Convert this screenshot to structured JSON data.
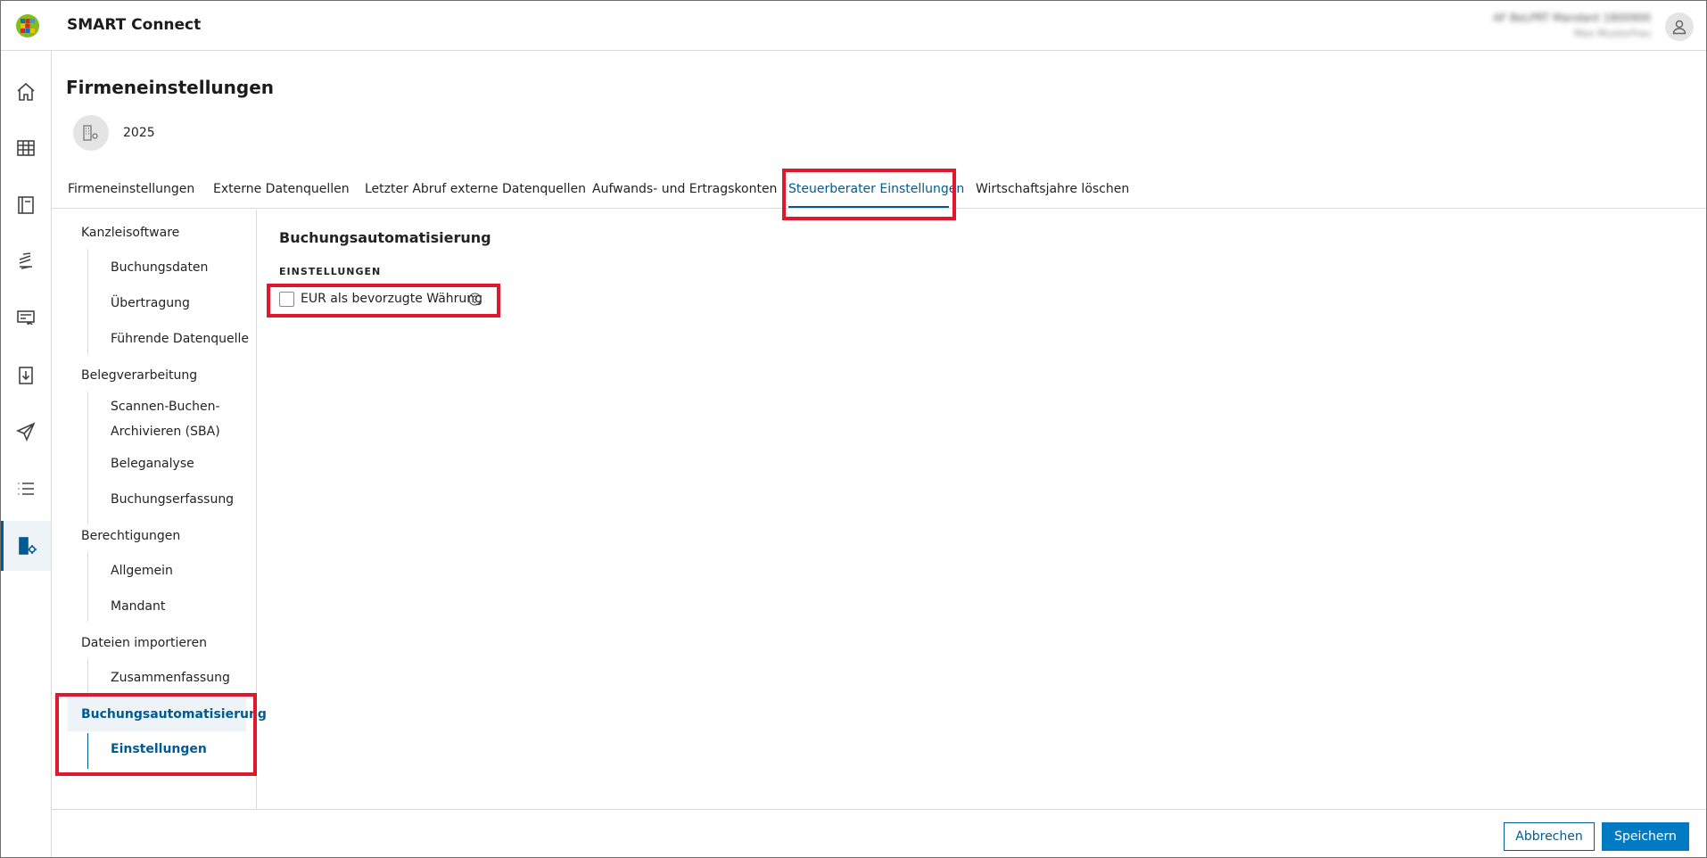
{
  "app": {
    "title": "SMART Connect",
    "user_name": "AF BeLPRT Mandant 1800900",
    "user_sub": "Max Musterfrau"
  },
  "rail": {
    "items": [
      {
        "icon": "home-icon"
      },
      {
        "icon": "table-icon"
      },
      {
        "icon": "book-icon"
      },
      {
        "icon": "coins-icon"
      },
      {
        "icon": "invoice-icon"
      },
      {
        "icon": "download-icon"
      },
      {
        "icon": "send-icon"
      },
      {
        "icon": "list-icon"
      },
      {
        "icon": "company-settings-icon",
        "active": true
      }
    ],
    "expand_icon": "double-chevron-right-icon"
  },
  "page": {
    "title": "Firmeneinstellungen",
    "year": "2025"
  },
  "tabs": [
    {
      "label": "Firmeneinstellungen"
    },
    {
      "label": "Externe Datenquellen"
    },
    {
      "label": "Letzter Abruf externe Datenquellen"
    },
    {
      "label": "Aufwands- und Ertragskonten"
    },
    {
      "label": "Steuerberater Einstellungen",
      "active": true
    },
    {
      "label": "Wirtschaftsjahre löschen"
    }
  ],
  "nav": {
    "kanzlei": "Kanzleisoftware",
    "kanzlei_items": [
      "Buchungsdaten",
      "Übertragung",
      "Führende Datenquelle"
    ],
    "beleg": "Belegverarbeitung",
    "beleg_items": [
      "Scannen-Buchen-",
      "Archivieren (SBA)",
      "Beleganalyse",
      "Buchungserfassung"
    ],
    "berecht": "Berechtigungen",
    "berecht_items": [
      "Allgemein",
      "Mandant"
    ],
    "import": "Dateien importieren",
    "import_items": [
      "Zusammenfassung"
    ],
    "auto": "Buchungsautomatisierung",
    "auto_items": [
      "Einstellungen"
    ]
  },
  "content": {
    "section_title": "Buchungsautomatisierung",
    "subheading": "EINSTELLUNGEN",
    "checkbox_label": "EUR als bevorzugte Währung",
    "checkbox_checked": false
  },
  "footer": {
    "cancel_label": "Abbrechen",
    "save_label": "Speichern"
  },
  "colors": {
    "accent": "#005b92",
    "primary_button": "#007ac3",
    "highlight": "#e0182d"
  }
}
